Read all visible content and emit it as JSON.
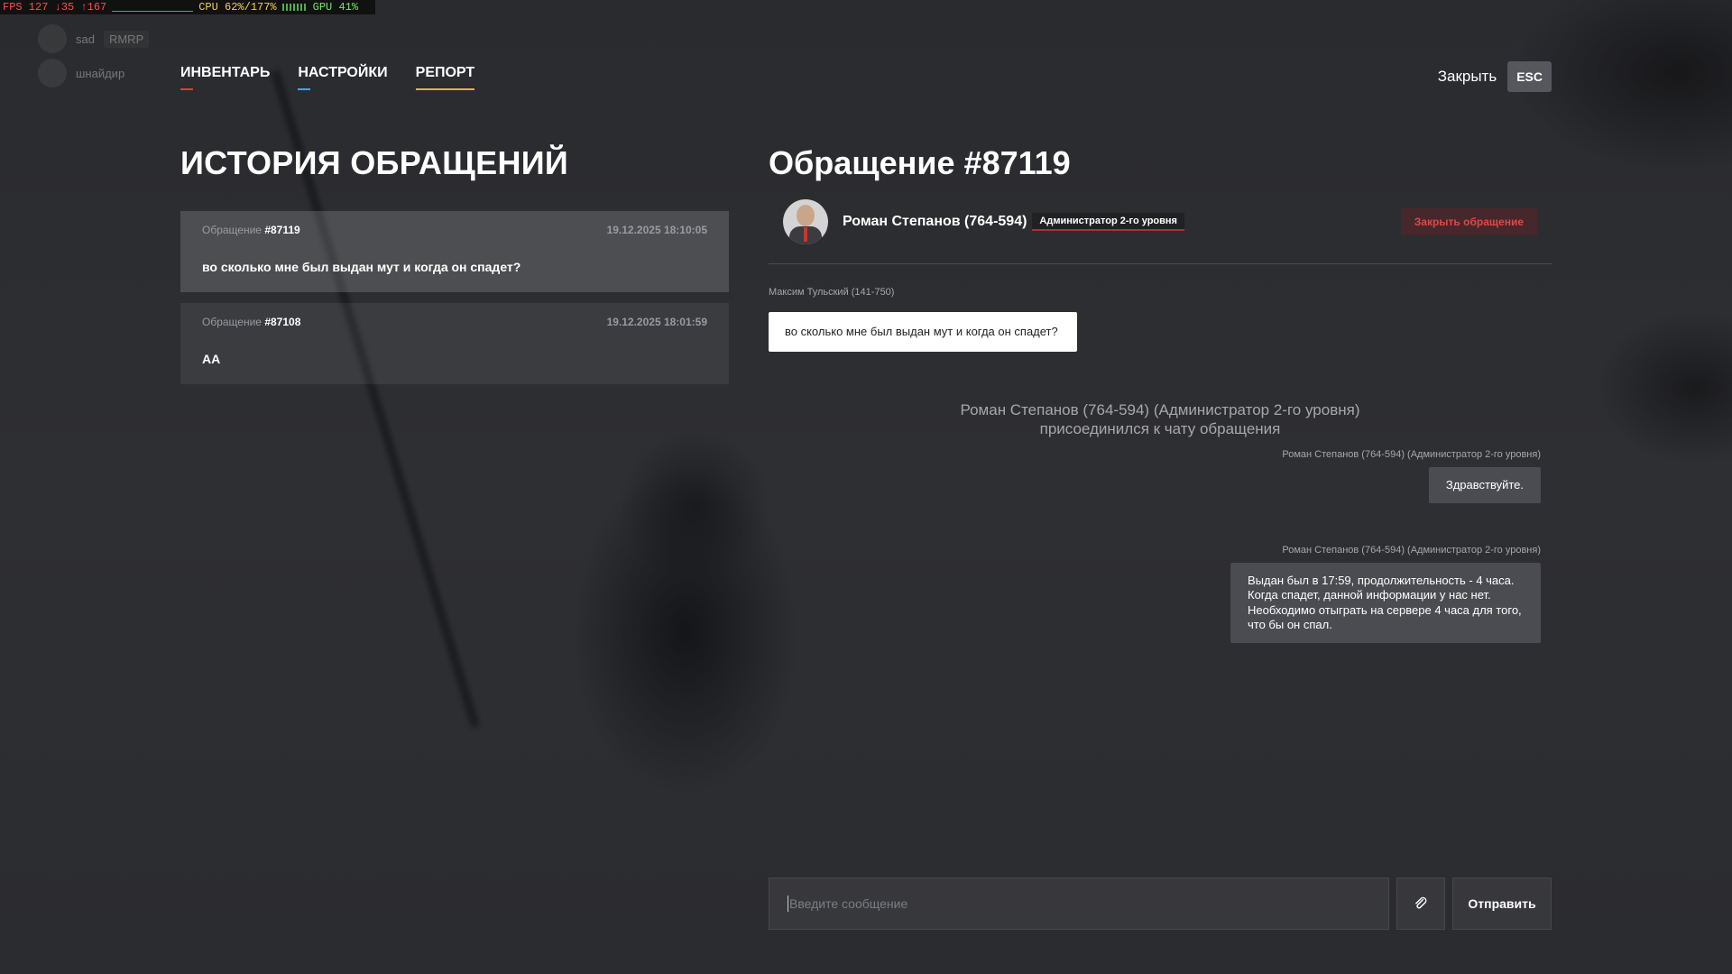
{
  "perf": {
    "fps": "FPS 127 ↓35 ↑167",
    "cpu": "CPU 62%/177%",
    "gpu": "GPU 41%"
  },
  "voice": {
    "items": [
      {
        "name": "sad",
        "tag": "RMRP"
      },
      {
        "name": "шнайдир"
      }
    ]
  },
  "nav": {
    "tabs": [
      {
        "label": "ИНВЕНТАРЬ",
        "color": "#e03c3c"
      },
      {
        "label": "НАСТРОЙКИ",
        "color": "#3ca9e0"
      },
      {
        "label": "РЕПОРТ",
        "color": "#e0b43c"
      }
    ],
    "close_label": "Закрыть",
    "esc_label": "ESC"
  },
  "history": {
    "title": "ИСТОРИЯ ОБРАЩЕНИЙ",
    "tickets": [
      {
        "label": "Обращение",
        "number": "#87119",
        "date": "19.12.2025 18:10:05",
        "text": "во сколько мне был выдан мут и когда он спадет?"
      },
      {
        "label": "Обращение",
        "number": "#87108",
        "date": "19.12.2025 18:01:59",
        "text": "АА"
      }
    ]
  },
  "ticket": {
    "title": "Обращение #87119",
    "admin_name": "Роман Степанов (764-594)",
    "admin_role": "Администратор 2-го уровня",
    "close_button": "Закрыть обращение",
    "messages": {
      "user_author": "Максим Тульский (141-750)",
      "user_text": "во сколько мне был выдан мут и когда он спадет?",
      "system_text_1": "Роман Степанов (764-594) (Администратор 2-го уровня)",
      "system_text_2": "присоединился к чату обращения",
      "admin_author_1": "Роман Степанов (764-594) (Администратор 2-го уровня)",
      "admin_text_1": "Здравствуйте.",
      "admin_author_2": "Роман Степанов (764-594) (Администратор 2-го уровня)",
      "admin_text_2": "Выдан был в 17:59, продолжительность - 4 часа. Когда спадет, данной информации у нас нет. Необходимо отыграть на сервере 4 часа для того, что бы он спал."
    },
    "input_placeholder": "Введите сообщение",
    "send_label": "Отправить"
  }
}
